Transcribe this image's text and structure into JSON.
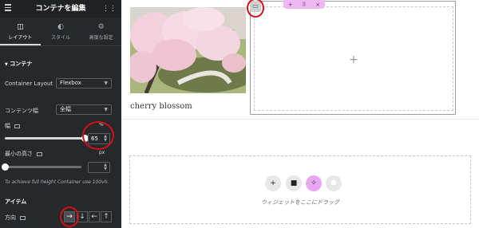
{
  "panel": {
    "title": "コンテナを編集",
    "tabs": [
      {
        "label": "レイアウト",
        "icon": "layout-icon",
        "active": true
      },
      {
        "label": "スタイル",
        "icon": "style-icon",
        "active": false
      },
      {
        "label": "高度な設定",
        "icon": "advanced-gear-icon",
        "active": false
      }
    ],
    "section_container": "コンテナ",
    "container_layout": {
      "label": "Container Layout",
      "value": "Flexbox"
    },
    "content_width": {
      "label": "コンテンツ幅",
      "value": "全幅"
    },
    "width": {
      "label": "幅",
      "unit": "%",
      "value": "65",
      "slider_fraction": 0.65
    },
    "min_height": {
      "label": "最小の高さ",
      "unit": "px",
      "value": "",
      "slider_fraction": 0
    },
    "hint": "To achieve full height Container use 100vh.",
    "section_items": "アイテム",
    "direction": {
      "label": "方向",
      "options": [
        {
          "glyph": "→",
          "name": "row",
          "active": true
        },
        {
          "glyph": "↓",
          "name": "column",
          "active": false
        },
        {
          "glyph": "←",
          "name": "row-reverse",
          "active": false
        },
        {
          "glyph": "↑",
          "name": "column-reverse",
          "active": false
        }
      ]
    }
  },
  "canvas": {
    "caption": "cherry blossom",
    "container_toolbar": [
      "+",
      "⠿",
      "×"
    ],
    "empty_plus": "+",
    "drop_zone": {
      "text": "ウィジェットをここにドラッグ",
      "buttons": [
        "+",
        "■",
        "✧",
        "☗"
      ]
    }
  },
  "colors": {
    "panel_bg": "#26292c",
    "highlight_circle": "#d40f16",
    "container_toolbar": "#efb8f5",
    "ai_button": "#e8a6f0"
  }
}
